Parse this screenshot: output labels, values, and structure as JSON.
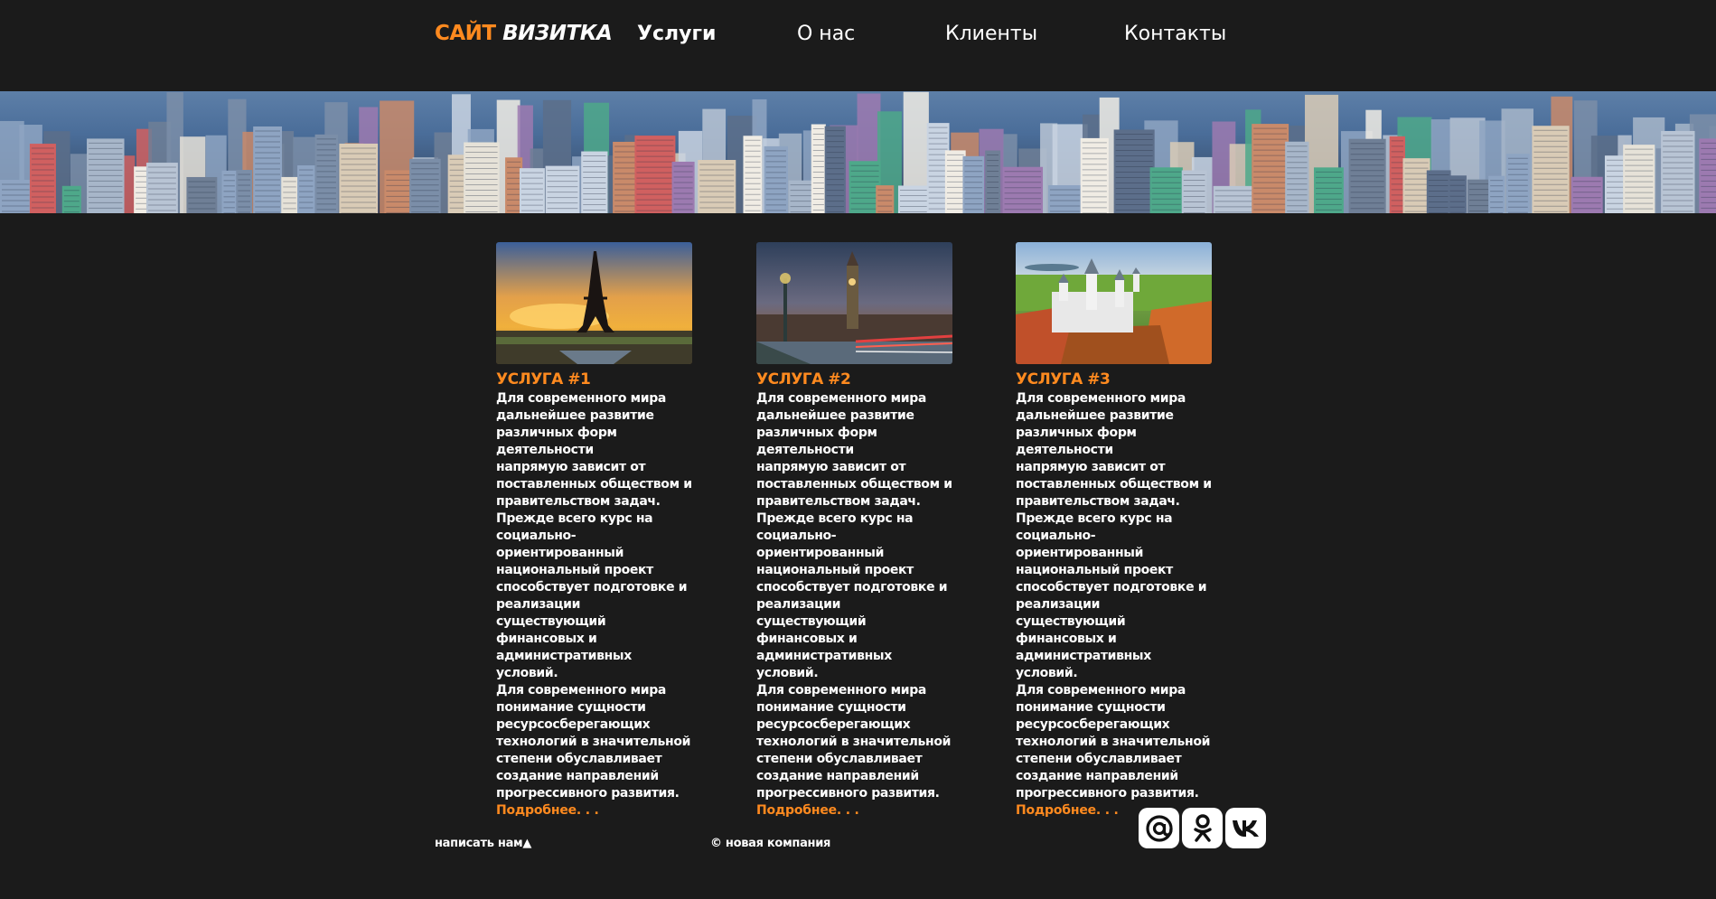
{
  "header": {
    "logo_part1": "САЙТ",
    "logo_part2": "ВИЗИТКА",
    "nav": [
      {
        "label": "Услуги",
        "active": true
      },
      {
        "label": "О нас",
        "active": false
      },
      {
        "label": "Клиенты",
        "active": false
      },
      {
        "label": "Контакты",
        "active": false
      }
    ]
  },
  "colors": {
    "accent": "#ff8a1f",
    "background": "#1b1b1b",
    "text": "#ffffff"
  },
  "cards": [
    {
      "title": "УСЛУГА #1",
      "image": "eiffel-tower-sunset",
      "text": "Для современного мира\nдальнейшее развитие\nразличных форм деятельности\nнапрямую зависит от\nпоставленных обществом и\nправительством задач.\nПрежде всего курс на\nсоциально-ориентированный\nнациональный проект\nспособствует подготовке и\nреализации существующий\nфинансовых и\nадминистративных условий.\nДля современного мира\nпонимание сущности\nресурсосберегающих\nтехнологий в значительной\nстепени обуславливает\nсоздание направлений\nпрогрессивного развития.",
      "more": "Подробнее. . ."
    },
    {
      "title": "УСЛУГА #2",
      "image": "big-ben-bridge",
      "text": "Для современного мира\nдальнейшее развитие\nразличных форм деятельности\nнапрямую зависит от\nпоставленных обществом и\nправительством задач.\nПрежде всего курс на\nсоциально-ориентированный\nнациональный проект\nспособствует подготовке и\nреализации существующий\nфинансовых и\nадминистративных условий.\nДля современного мира\nпонимание сущности\nресурсосберегающих\nтехнологий в значительной\nстепени обуславливает\nсоздание направлений\nпрогрессивного развития.",
      "more": "Подробнее. . ."
    },
    {
      "title": "УСЛУГА #3",
      "image": "castle-autumn",
      "text": "Для современного мира\nдальнейшее развитие\nразличных форм деятельности\nнапрямую зависит от\nпоставленных обществом и\nправительством задач.\nПрежде всего курс на\nсоциально-ориентированный\nнациональный проект\nспособствует подготовке и\nреализации существующий\nфинансовых и\nадминистративных условий.\nДля современного мира\nпонимание сущности\nресурсосберегающих\nтехнологий в значительной\nстепени обуславливает\nсоздание направлений\nпрогрессивного развития.",
      "more": "Подробнее. . ."
    }
  ],
  "footer": {
    "write_us": "написать нам▲",
    "copyright": "© новая компания",
    "social": [
      "mail-icon",
      "odnoklassniki-icon",
      "vk-icon"
    ]
  }
}
